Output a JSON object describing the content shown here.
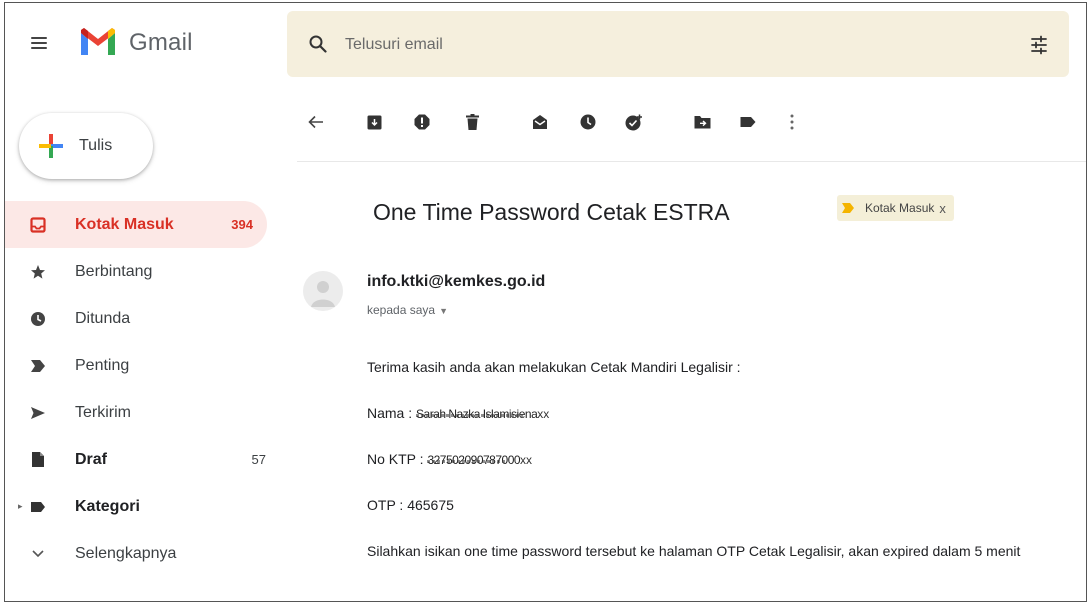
{
  "header": {
    "app_name": "Gmail",
    "search_placeholder": "Telusuri email"
  },
  "sidebar": {
    "compose_label": "Tulis",
    "items": [
      {
        "label": "Kotak Masuk",
        "count": "394",
        "icon": "inbox-icon",
        "active": true
      },
      {
        "label": "Berbintang",
        "count": "",
        "icon": "star-icon"
      },
      {
        "label": "Ditunda",
        "count": "",
        "icon": "clock-icon"
      },
      {
        "label": "Penting",
        "count": "",
        "icon": "important-icon"
      },
      {
        "label": "Terkirim",
        "count": "",
        "icon": "send-icon"
      },
      {
        "label": "Draf",
        "count": "57",
        "icon": "draft-icon"
      },
      {
        "label": "Kategori",
        "count": "",
        "icon": "label-icon"
      },
      {
        "label": "Selengkapnya",
        "count": "",
        "icon": "chevron-down-icon"
      }
    ]
  },
  "toolbar": {
    "icons": [
      "back-arrow-icon",
      "archive-icon",
      "report-spam-icon",
      "delete-icon",
      "mark-unread-icon",
      "snooze-icon",
      "add-task-icon",
      "move-to-icon",
      "label-icon",
      "more-icon"
    ]
  },
  "message": {
    "subject": "One Time Password Cetak ESTRA",
    "label_chip": "Kotak Masuk",
    "label_chip_close": "x",
    "sender": "info.ktki@kemkes.go.id",
    "recipient": "kepada saya",
    "body": {
      "intro": "Terima kasih anda akan melakukan Cetak Mandiri Legalisir :",
      "name_label": "Nama : ",
      "name_value": "Sarah Nazka Islamisiena",
      "name_suffix": "xx",
      "ktp_label": "No KTP : ",
      "ktp_value": "327502090787000",
      "ktp_suffix": "xx",
      "otp": "OTP : 465675",
      "instruction": "Silahkan isikan one time password tersebut ke halaman OTP Cetak Legalisir, akan expired dalam 5 menit"
    }
  },
  "colors": {
    "accent_red": "#d93025",
    "active_bg": "#fce8e6",
    "search_bg": "#f5efdd",
    "label_yellow": "#f4b400"
  }
}
